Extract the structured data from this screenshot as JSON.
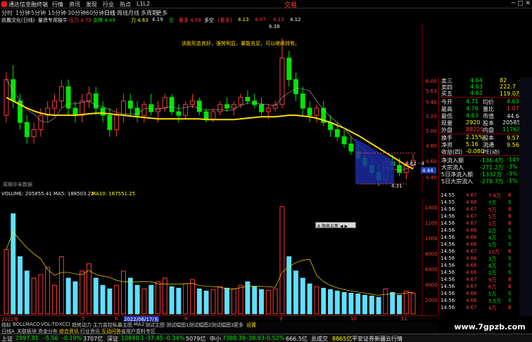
{
  "titlebar": {
    "app_name": "通达信金融终端",
    "brand": "交易",
    "win_controls": "─ □ ✕"
  },
  "menu": [
    "行情",
    "资讯",
    "发现",
    "行业",
    "热点",
    "L1L2"
  ],
  "periods": [
    "分时",
    "1分钟",
    "5分钟",
    "15分钟",
    "30分钟",
    "60分钟",
    "日线",
    "周线",
    "月线",
    "多周期",
    "更多"
  ],
  "infobar": {
    "stock": "凯撒文化(日线)",
    "template": "量资专用操牛",
    "pressure_label": "压力 4.73",
    "support_label": "支撑 4.49",
    "force_label": "力 4.63",
    "val2": "4.19",
    "kong_label": "空",
    "kong2_label": "看多 4.59",
    "duo_label": "多空",
    "bull_tag": "[看多]",
    "price_a": "4.13",
    "price_b": "4.07",
    "price_c": "4.13",
    "price_d": "4.12"
  },
  "annotations": {
    "comment": "该股形态良好，强势明显，量能充足，可以继续持有。",
    "high_price": "6.38",
    "low_price": "4.31",
    "right_price": "4.62",
    "label_mid": "4.82 - 4",
    "no_data": "周期中未数据"
  },
  "y_axis": [
    "6.00",
    "5.63",
    "5.40",
    "5.20",
    "5.00",
    "4.80",
    "4.60",
    "4.44",
    "4.40"
  ],
  "vol_axis": [
    "14000",
    "12000",
    "10000",
    "8000",
    "6000",
    "4000",
    "2000"
  ],
  "vol_header": {
    "volume": "VOLUME: 205855.41",
    "ma5": "MA5: 188503.22",
    "ma10": "MA10: 167551.25"
  },
  "dates": [
    "2022年",
    "5",
    "6",
    "2022/06/17/五",
    "8",
    "9",
    "10",
    "11"
  ],
  "indicator_tabs": [
    "指标",
    "BOLL",
    "MACD",
    "VOL-TDX",
    "CCI",
    "趋势动力",
    "主力监控",
    "私募主图",
    "MA2",
    "测试主图",
    "测试幅图1",
    "测试幅图2",
    "测试幅图3",
    "更多",
    "设置"
  ],
  "sub_tabs": [
    "日线A",
    "关联板块",
    "资金分布",
    "综合资讯",
    "行业资讯",
    "互动问答",
    "省用户意料专区"
  ],
  "tooltip": "A 限高五笔 ◀ ▶",
  "quote": {
    "sell_rows": [
      {
        "label": "卖三",
        "price": "4.64",
        "vol": "82"
      },
      {
        "label": "卖四",
        "price": "4.63",
        "vol": "222.7"
      },
      {
        "label": "买五",
        "price": "4.62",
        "vol": "119.0万"
      }
    ],
    "stats": [
      {
        "k1": "今开",
        "v1": "4.71",
        "k2": "均价",
        "v2": "4.63"
      },
      {
        "k1": "最高",
        "v1": "4.76",
        "k2": "量比",
        "v2": "1.07"
      },
      {
        "k1": "最低",
        "v1": "4.63",
        "k2": "市值",
        "v2": "44.6亿"
      },
      {
        "k1": "现量",
        "v1": "2920",
        "k2": "股本",
        "v2": "205855"
      },
      {
        "k1": "外盘",
        "v1": "88225",
        "k2": "内盘",
        "v2": "117630"
      },
      {
        "k1": "换手",
        "v1": "2.15%",
        "k2": "股本",
        "v2": "9.57亿"
      },
      {
        "k1": "净资",
        "v1": "5.16",
        "k2": "流通",
        "v2": "9.56亿"
      },
      {
        "k1": "收益(四)",
        "v1": "-0.080",
        "k2": "PE(动)",
        "v2": ""
      }
    ],
    "flows": [
      {
        "label": "净流入额",
        "val": "-136.4万",
        "pct": "-14%"
      },
      {
        "label": "大宗流入",
        "val": "-271.2万",
        "pct": "-3%"
      },
      {
        "label": "5日净流入额",
        "val": "-1332万",
        "pct": "-3%"
      },
      {
        "label": "5日大宗流入",
        "val": "-278.7万",
        "pct": "-1%"
      }
    ]
  },
  "ticks": [
    {
      "t": "14:55",
      "p": "4.67",
      "v": "7.8万",
      "s": "B"
    },
    {
      "t": "14:55",
      "p": "4.66",
      "v": "7万",
      "s": "S"
    },
    {
      "t": "14:56",
      "p": "4.67",
      "v": "9万",
      "s": "B"
    },
    {
      "t": "14:56",
      "p": "4.67",
      "v": "5万",
      "s": "B"
    },
    {
      "t": "14:56",
      "p": "4.67",
      "v": "3万",
      "s": "B"
    },
    {
      "t": "14:56",
      "p": "4.66",
      "v": "2万",
      "s": "S"
    },
    {
      "t": "14:56",
      "p": "4.66",
      "v": "4万",
      "s": "S"
    },
    {
      "t": "14:56",
      "p": "4.66",
      "v": "1万",
      "s": "S"
    },
    {
      "t": "14:56",
      "p": "4.67",
      "v": "10万",
      "s": "B"
    },
    {
      "t": "14:56",
      "p": "4.66",
      "v": "3万",
      "s": "S"
    },
    {
      "t": "14:56",
      "p": "4.66",
      "v": "8万",
      "s": "S"
    },
    {
      "t": "14:56",
      "p": "4.66",
      "v": "2万",
      "s": "S"
    },
    {
      "t": "14:56",
      "p": "4.67",
      "v": "9万",
      "s": "B"
    },
    {
      "t": "14:56",
      "p": "4.67",
      "v": "6万",
      "s": "B"
    },
    {
      "t": "14:56",
      "p": "4.66",
      "v": "5万",
      "s": "S"
    },
    {
      "t": "14:56",
      "p": "4.66",
      "v": "5.5万",
      "s": "S"
    },
    {
      "t": "14:56",
      "p": "4.67",
      "v": "4万",
      "s": "B"
    }
  ],
  "statusbar": {
    "sh_label": "上证",
    "sh_val": "2997.81",
    "sh_chg": "-5.56",
    "sh_pct": "-0.19%",
    "sh_amt": "3707亿",
    "sz_label": "深证",
    "sz_val": "10840.1",
    "sz_chg": "-37.45",
    "sz_pct": "-0.34%",
    "sz_amt": "5079亿",
    "zx_label": "中小",
    "zx_val": "7388.38",
    "zx_chg": "-38.93",
    "zx_pct": "-0.52%",
    "zx_amt": "666.5亿",
    "total_label": "总成交",
    "total_val": "8865亿",
    "broker": "平安证券新疆云行情"
  },
  "watermark": "www.7gpzb.com",
  "colors": {
    "up": "#ff3b3b",
    "down": "#00e600",
    "ma_yellow": "#ffdd00",
    "vol_cyan": "#5fe0ff",
    "bg": "#000000"
  },
  "chart_data": {
    "type": "candlestick",
    "title": "凯撒文化(日线)",
    "ylim": [
      4.3,
      6.5
    ],
    "candles": [
      [
        5.3,
        5.9,
        5.2,
        5.8
      ],
      [
        5.8,
        6.0,
        5.4,
        5.5
      ],
      [
        5.5,
        5.6,
        5.1,
        5.2
      ],
      [
        5.2,
        5.3,
        4.9,
        5.0
      ],
      [
        5.0,
        5.2,
        4.9,
        5.1
      ],
      [
        5.1,
        5.4,
        5.0,
        5.3
      ],
      [
        5.3,
        5.5,
        5.2,
        5.4
      ],
      [
        5.4,
        5.6,
        5.3,
        5.5
      ],
      [
        5.5,
        5.8,
        5.4,
        5.7
      ],
      [
        5.7,
        5.8,
        5.3,
        5.4
      ],
      [
        5.4,
        5.5,
        5.2,
        5.3
      ],
      [
        5.3,
        5.6,
        5.2,
        5.5
      ],
      [
        5.5,
        5.7,
        5.4,
        5.6
      ],
      [
        5.6,
        5.7,
        5.3,
        5.4
      ],
      [
        5.4,
        5.5,
        5.2,
        5.3
      ],
      [
        5.3,
        5.4,
        5.0,
        5.1
      ],
      [
        5.1,
        5.4,
        5.0,
        5.3
      ],
      [
        5.3,
        5.6,
        5.2,
        5.5
      ],
      [
        5.5,
        5.6,
        5.3,
        5.4
      ],
      [
        5.4,
        5.5,
        5.2,
        5.3
      ],
      [
        5.3,
        5.5,
        5.2,
        5.45
      ],
      [
        5.45,
        5.6,
        5.3,
        5.35
      ],
      [
        5.35,
        5.5,
        5.2,
        5.4
      ],
      [
        5.4,
        5.6,
        5.35,
        5.55
      ],
      [
        5.55,
        5.6,
        5.3,
        5.35
      ],
      [
        5.35,
        5.45,
        5.2,
        5.3
      ],
      [
        5.3,
        5.5,
        5.25,
        5.45
      ],
      [
        5.45,
        5.6,
        5.4,
        5.5
      ],
      [
        5.5,
        5.55,
        5.3,
        5.35
      ],
      [
        5.35,
        5.4,
        5.2,
        5.25
      ],
      [
        5.25,
        5.4,
        5.2,
        5.35
      ],
      [
        5.35,
        5.5,
        5.3,
        5.45
      ],
      [
        5.45,
        5.55,
        5.35,
        5.4
      ],
      [
        5.4,
        5.5,
        5.3,
        5.45
      ],
      [
        5.45,
        5.6,
        5.4,
        5.55
      ],
      [
        5.55,
        5.65,
        5.45,
        5.5
      ],
      [
        5.5,
        5.6,
        5.4,
        5.45
      ],
      [
        5.45,
        5.55,
        5.3,
        5.35
      ],
      [
        5.35,
        5.45,
        5.25,
        5.4
      ],
      [
        5.4,
        5.5,
        5.35,
        5.45
      ],
      [
        5.45,
        6.38,
        5.4,
        6.1
      ],
      [
        6.1,
        6.2,
        5.7,
        5.8
      ],
      [
        5.8,
        5.9,
        5.5,
        5.6
      ],
      [
        5.6,
        5.7,
        5.3,
        5.4
      ],
      [
        5.4,
        5.5,
        5.2,
        5.3
      ],
      [
        5.3,
        5.45,
        5.2,
        5.4
      ],
      [
        5.4,
        5.5,
        5.15,
        5.2
      ],
      [
        5.2,
        5.3,
        5.0,
        5.1
      ],
      [
        5.1,
        5.2,
        4.95,
        5.0
      ],
      [
        5.0,
        5.1,
        4.85,
        4.9
      ],
      [
        4.9,
        5.0,
        4.75,
        4.8
      ],
      [
        4.8,
        4.9,
        4.65,
        4.7
      ],
      [
        4.7,
        4.8,
        4.55,
        4.6
      ],
      [
        4.6,
        4.7,
        4.45,
        4.5
      ],
      [
        4.5,
        4.6,
        4.31,
        4.4
      ],
      [
        4.4,
        4.7,
        4.35,
        4.65
      ],
      [
        4.65,
        4.75,
        4.55,
        4.6
      ],
      [
        4.6,
        4.7,
        4.45,
        4.5
      ],
      [
        4.5,
        4.65,
        4.4,
        4.6
      ],
      [
        4.6,
        4.76,
        4.55,
        4.67
      ]
    ],
    "ma_long": [
      5.55,
      5.5,
      5.45,
      5.4,
      5.36,
      5.33,
      5.31,
      5.3,
      5.3,
      5.3,
      5.3,
      5.31,
      5.32,
      5.33,
      5.33,
      5.32,
      5.31,
      5.3,
      5.29,
      5.28,
      5.27,
      5.26,
      5.25,
      5.25,
      5.25,
      5.25,
      5.25,
      5.25,
      5.25,
      5.24,
      5.24,
      5.24,
      5.24,
      5.24,
      5.25,
      5.26,
      5.27,
      5.28,
      5.28,
      5.28,
      5.29,
      5.3,
      5.3,
      5.29,
      5.28,
      5.26,
      5.23,
      5.2,
      5.16,
      5.12,
      5.07,
      5.02,
      4.96,
      4.9,
      4.84,
      4.78,
      4.72,
      4.66,
      4.6,
      4.55
    ],
    "volume": [
      9000,
      14000,
      8000,
      6000,
      5000,
      5500,
      6500,
      4000,
      8000,
      5000,
      4500,
      6000,
      7000,
      5000,
      4000,
      3500,
      4000,
      6000,
      5000,
      4000,
      3500,
      4000,
      4500,
      5000,
      3800,
      3600,
      4200,
      4800,
      3500,
      3200,
      3400,
      3800,
      3600,
      3500,
      4000,
      4500,
      3800,
      3400,
      3300,
      3500,
      15000,
      8000,
      6000,
      5000,
      4200,
      3800,
      3600,
      3400,
      3200,
      3000,
      2900,
      2800,
      2600,
      2500,
      2300,
      3500,
      3000,
      2600,
      3200,
      2900
    ]
  }
}
